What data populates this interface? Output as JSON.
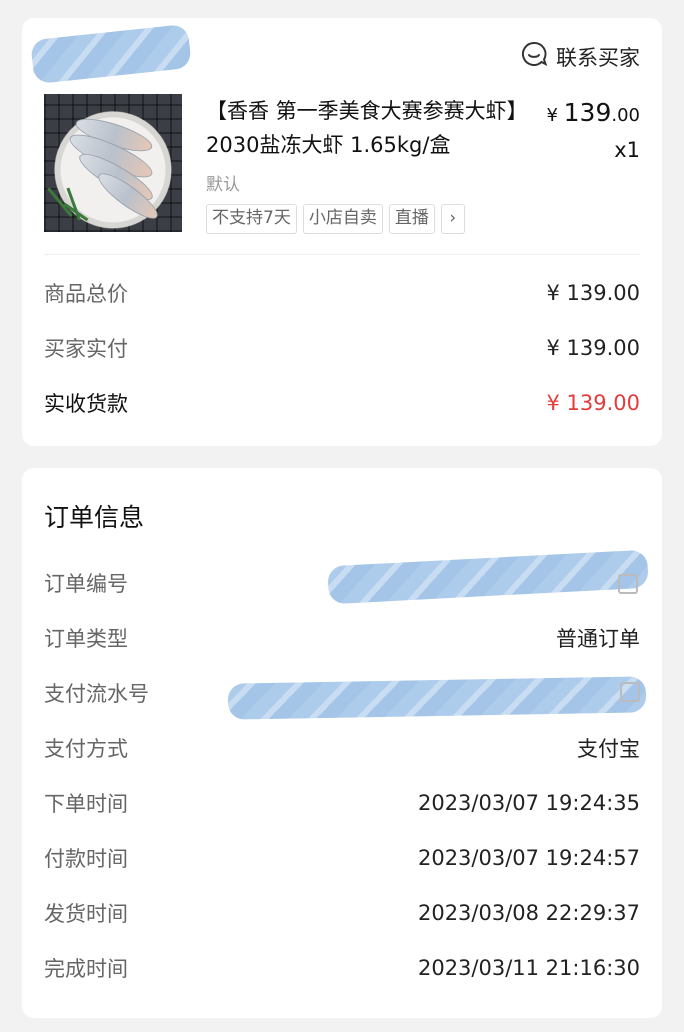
{
  "order_card": {
    "contact_label": "联系买家",
    "product": {
      "title": "【香香  第一季美食大赛参赛大虾】2030盐冻大虾  1.65kg/盒",
      "currency": "¥",
      "price_int": "139",
      "price_dec": ".00",
      "quantity": "x1",
      "variant": "默认",
      "tags": [
        "不支持7天",
        "小店自卖",
        "直播"
      ],
      "tags_more": "›"
    },
    "summary": [
      {
        "label": "商品总价",
        "value": "¥ 139.00"
      },
      {
        "label": "买家实付",
        "value": "¥ 139.00"
      },
      {
        "label": "实收货款",
        "value": "¥ 139.00"
      }
    ],
    "accent_color": "#e23c3c"
  },
  "order_info": {
    "title": "订单信息",
    "rows": [
      {
        "label": "订单编号",
        "value": ""
      },
      {
        "label": "订单类型",
        "value": "普通订单"
      },
      {
        "label": "支付流水号",
        "value": ""
      },
      {
        "label": "支付方式",
        "value": "支付宝"
      },
      {
        "label": "下单时间",
        "value": "2023/03/07 19:24:35"
      },
      {
        "label": "付款时间",
        "value": "2023/03/07 19:24:57"
      },
      {
        "label": "发货时间",
        "value": "2023/03/08 22:29:37"
      },
      {
        "label": "完成时间",
        "value": "2023/03/11 21:16:30"
      }
    ]
  },
  "icons": {
    "contact": "chat-bubble-icon",
    "copy": "copy-icon",
    "more": "chevron-right-icon"
  }
}
